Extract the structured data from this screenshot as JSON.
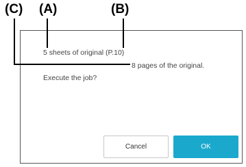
{
  "callouts": {
    "a": "(A)",
    "b": "(B)",
    "c": "(C)"
  },
  "dialog": {
    "line1": "5 sheets of original (P.10)",
    "line2": "8 pages of the original.",
    "line3": "Execute the job?",
    "cancel_label": "Cancel",
    "ok_label": "OK"
  },
  "colors": {
    "ok_button": "#1aa8cc",
    "dialog_border": "#555555"
  }
}
